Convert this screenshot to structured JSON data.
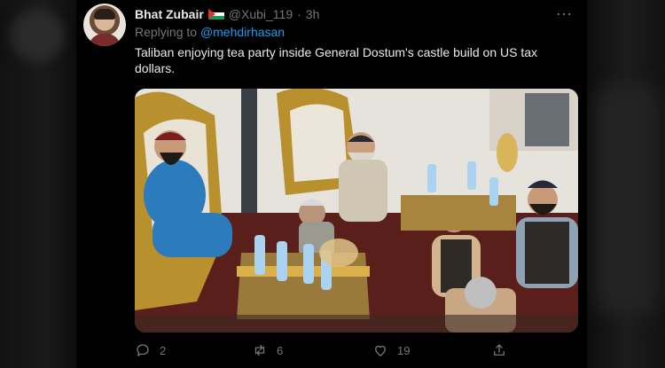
{
  "tweet": {
    "author_name": "Bhat Zubair",
    "handle": "@Xubi_119",
    "separator": "·",
    "time": "3h",
    "reply_prefix": "Replying to",
    "reply_to": "@mehdirhasan",
    "text": "Taliban enjoying tea party inside General Dostum's castle build on US tax dollars.",
    "more_icon": "⋯"
  },
  "actions": {
    "replies": "2",
    "retweets": "6",
    "likes": "19"
  },
  "icons": {
    "flag": "palestine-flag-icon",
    "reply": "reply-icon",
    "retweet": "retweet-icon",
    "like": "heart-icon",
    "share": "share-icon"
  },
  "colors": {
    "background": "#000000",
    "text": "#e7e9ea",
    "muted": "#71767b",
    "link": "#1d9bf0"
  }
}
